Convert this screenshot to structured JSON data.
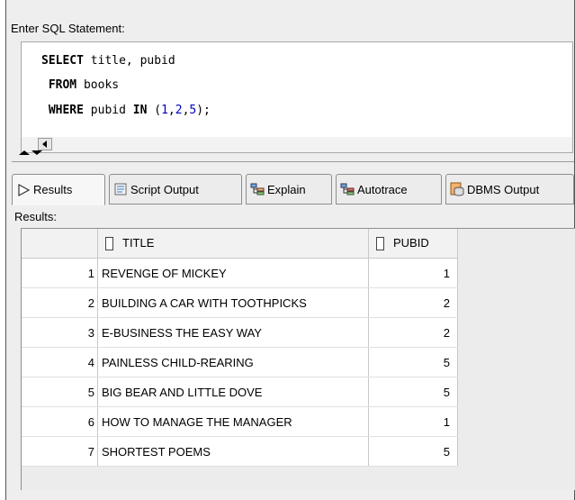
{
  "editor": {
    "label": "Enter SQL Statement:",
    "lines": [
      [
        {
          "text": "SELECT",
          "cls": "kw"
        },
        {
          "text": " title, pubid",
          "cls": ""
        }
      ],
      [
        {
          "text": " FROM",
          "cls": "kw"
        },
        {
          "text": " books",
          "cls": ""
        }
      ],
      [
        {
          "text": " WHERE",
          "cls": "kw"
        },
        {
          "text": " pubid ",
          "cls": ""
        },
        {
          "text": "IN",
          "cls": "kw"
        },
        {
          "text": " (",
          "cls": ""
        },
        {
          "text": "1",
          "cls": "num"
        },
        {
          "text": ",",
          "cls": ""
        },
        {
          "text": "2",
          "cls": "num"
        },
        {
          "text": ",",
          "cls": ""
        },
        {
          "text": "5",
          "cls": "num"
        },
        {
          "text": ");",
          "cls": ""
        }
      ]
    ]
  },
  "tabs": [
    {
      "label": "Results",
      "icon": "run-arrow-icon",
      "active": true
    },
    {
      "label": "Script Output",
      "icon": "script-output-icon",
      "active": false
    },
    {
      "label": "Explain",
      "icon": "explain-plan-icon",
      "active": false
    },
    {
      "label": "Autotrace",
      "icon": "autotrace-icon",
      "active": false
    },
    {
      "label": "DBMS Output",
      "icon": "dbms-output-icon",
      "active": false
    }
  ],
  "results": {
    "label": "Results:",
    "columns": [
      "TITLE",
      "PUBID"
    ],
    "rows": [
      {
        "n": "1",
        "title": "REVENGE OF MICKEY",
        "pubid": "1"
      },
      {
        "n": "2",
        "title": "BUILDING A CAR WITH TOOTHPICKS",
        "pubid": "2"
      },
      {
        "n": "3",
        "title": "E-BUSINESS THE EASY WAY",
        "pubid": "2"
      },
      {
        "n": "4",
        "title": "PAINLESS CHILD-REARING",
        "pubid": "5"
      },
      {
        "n": "5",
        "title": "BIG BEAR AND LITTLE DOVE",
        "pubid": "5"
      },
      {
        "n": "6",
        "title": "HOW TO MANAGE THE MANAGER",
        "pubid": "1"
      },
      {
        "n": "7",
        "title": "SHORTEST POEMS",
        "pubid": "5"
      }
    ]
  }
}
